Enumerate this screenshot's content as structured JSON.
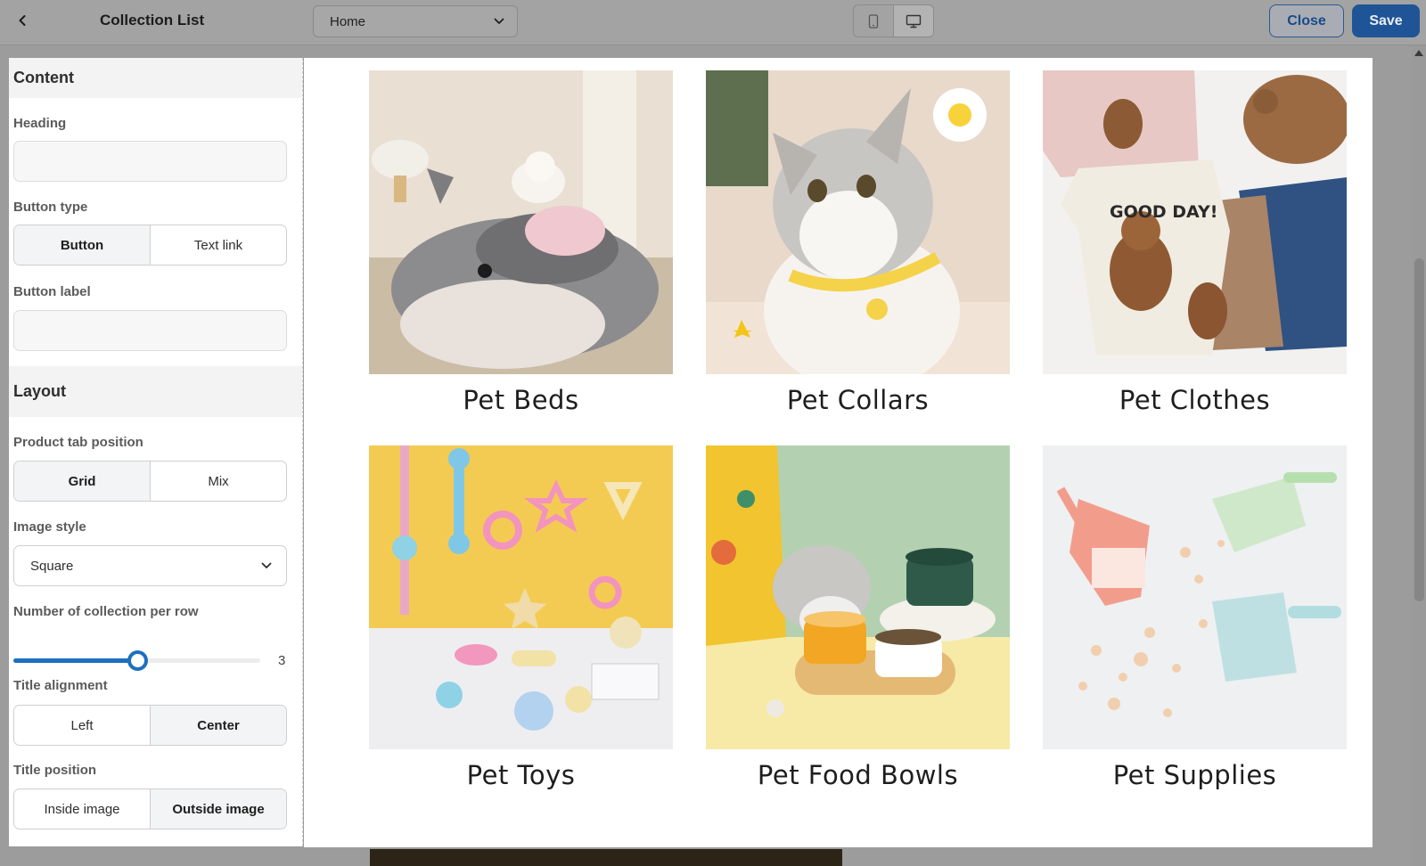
{
  "header": {
    "title": "Collection List",
    "page_select": "Home",
    "close_label": "Close",
    "save_label": "Save"
  },
  "settings": {
    "content": {
      "title": "Content",
      "heading_label": "Heading",
      "heading_value": "",
      "button_type_label": "Button type",
      "button_type_options": [
        "Button",
        "Text link"
      ],
      "button_type_selected": "Button",
      "button_label_label": "Button label",
      "button_label_value": ""
    },
    "layout": {
      "title": "Layout",
      "product_tab_label": "Product tab position",
      "product_tab_options": [
        "Grid",
        "Mix"
      ],
      "product_tab_selected": "Grid",
      "image_style_label": "Image style",
      "image_style_value": "Square",
      "per_row_label": "Number of collection per row",
      "per_row_value": "3",
      "per_row_fraction": 0.5,
      "title_alignment_label": "Title alignment",
      "title_alignment_options": [
        "Left",
        "Center"
      ],
      "title_alignment_selected": "Center",
      "title_position_label": "Title position",
      "title_position_options": [
        "Inside image",
        "Outside image"
      ],
      "title_position_selected": "Outside image"
    }
  },
  "preview": {
    "collections": [
      {
        "title": "Pet Beds",
        "image": "pet-bed-photo"
      },
      {
        "title": "Pet Collars",
        "image": "kitten-collar-photo"
      },
      {
        "title": "Pet Clothes",
        "image": "bear-sweaters-photo"
      },
      {
        "title": "Pet Toys",
        "image": "rope-toys-photo"
      },
      {
        "title": "Pet Food Bowls",
        "image": "cat-bowls-photo"
      },
      {
        "title": "Pet Supplies",
        "image": "litter-scoop-photo"
      }
    ]
  },
  "icons": {
    "back": "chevron-left-icon",
    "dropdown": "chevron-down-icon",
    "mobile": "mobile-icon",
    "desktop": "desktop-icon"
  },
  "colors": {
    "accent": "#1d6fbf",
    "save_button": "#1f5596",
    "overlay": "#a3a3a3"
  }
}
